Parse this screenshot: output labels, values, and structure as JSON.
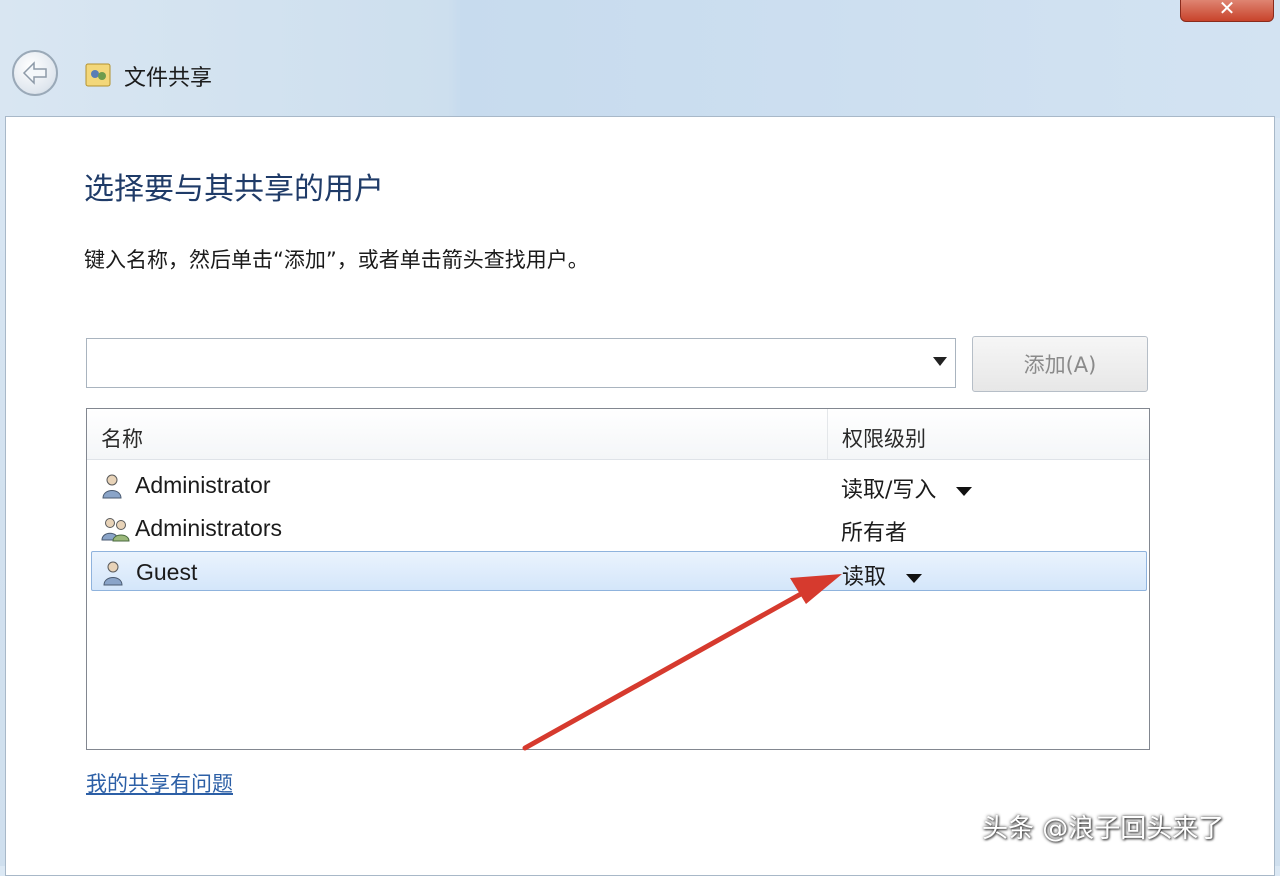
{
  "window": {
    "title": "文件共享",
    "close_label": "✕"
  },
  "dialog": {
    "heading": "选择要与其共享的用户",
    "instructions": "键入名称，然后单击“添加”，或者单击箭头查找用户。",
    "name_input": {
      "value": "",
      "placeholder": ""
    },
    "add_button": "添加(A)"
  },
  "list": {
    "columns": {
      "name": "名称",
      "permission": "权限级别"
    },
    "rows": [
      {
        "name": "Administrator",
        "permission": "读取/写入",
        "icon": "user-icon",
        "has_dropdown": true
      },
      {
        "name": "Administrators",
        "permission": "所有者",
        "icon": "users-group-icon",
        "has_dropdown": false
      },
      {
        "name": "Guest",
        "permission": "读取",
        "icon": "user-icon",
        "has_dropdown": true,
        "selected": true
      }
    ]
  },
  "help_link": "我的共享有问题",
  "watermark": "头条 @浪子回头来了",
  "colors": {
    "heading": "#1f3b68",
    "link": "#2c5fa6",
    "selection": "#d4e6fa",
    "annotation_arrow": "#d63a2e"
  }
}
